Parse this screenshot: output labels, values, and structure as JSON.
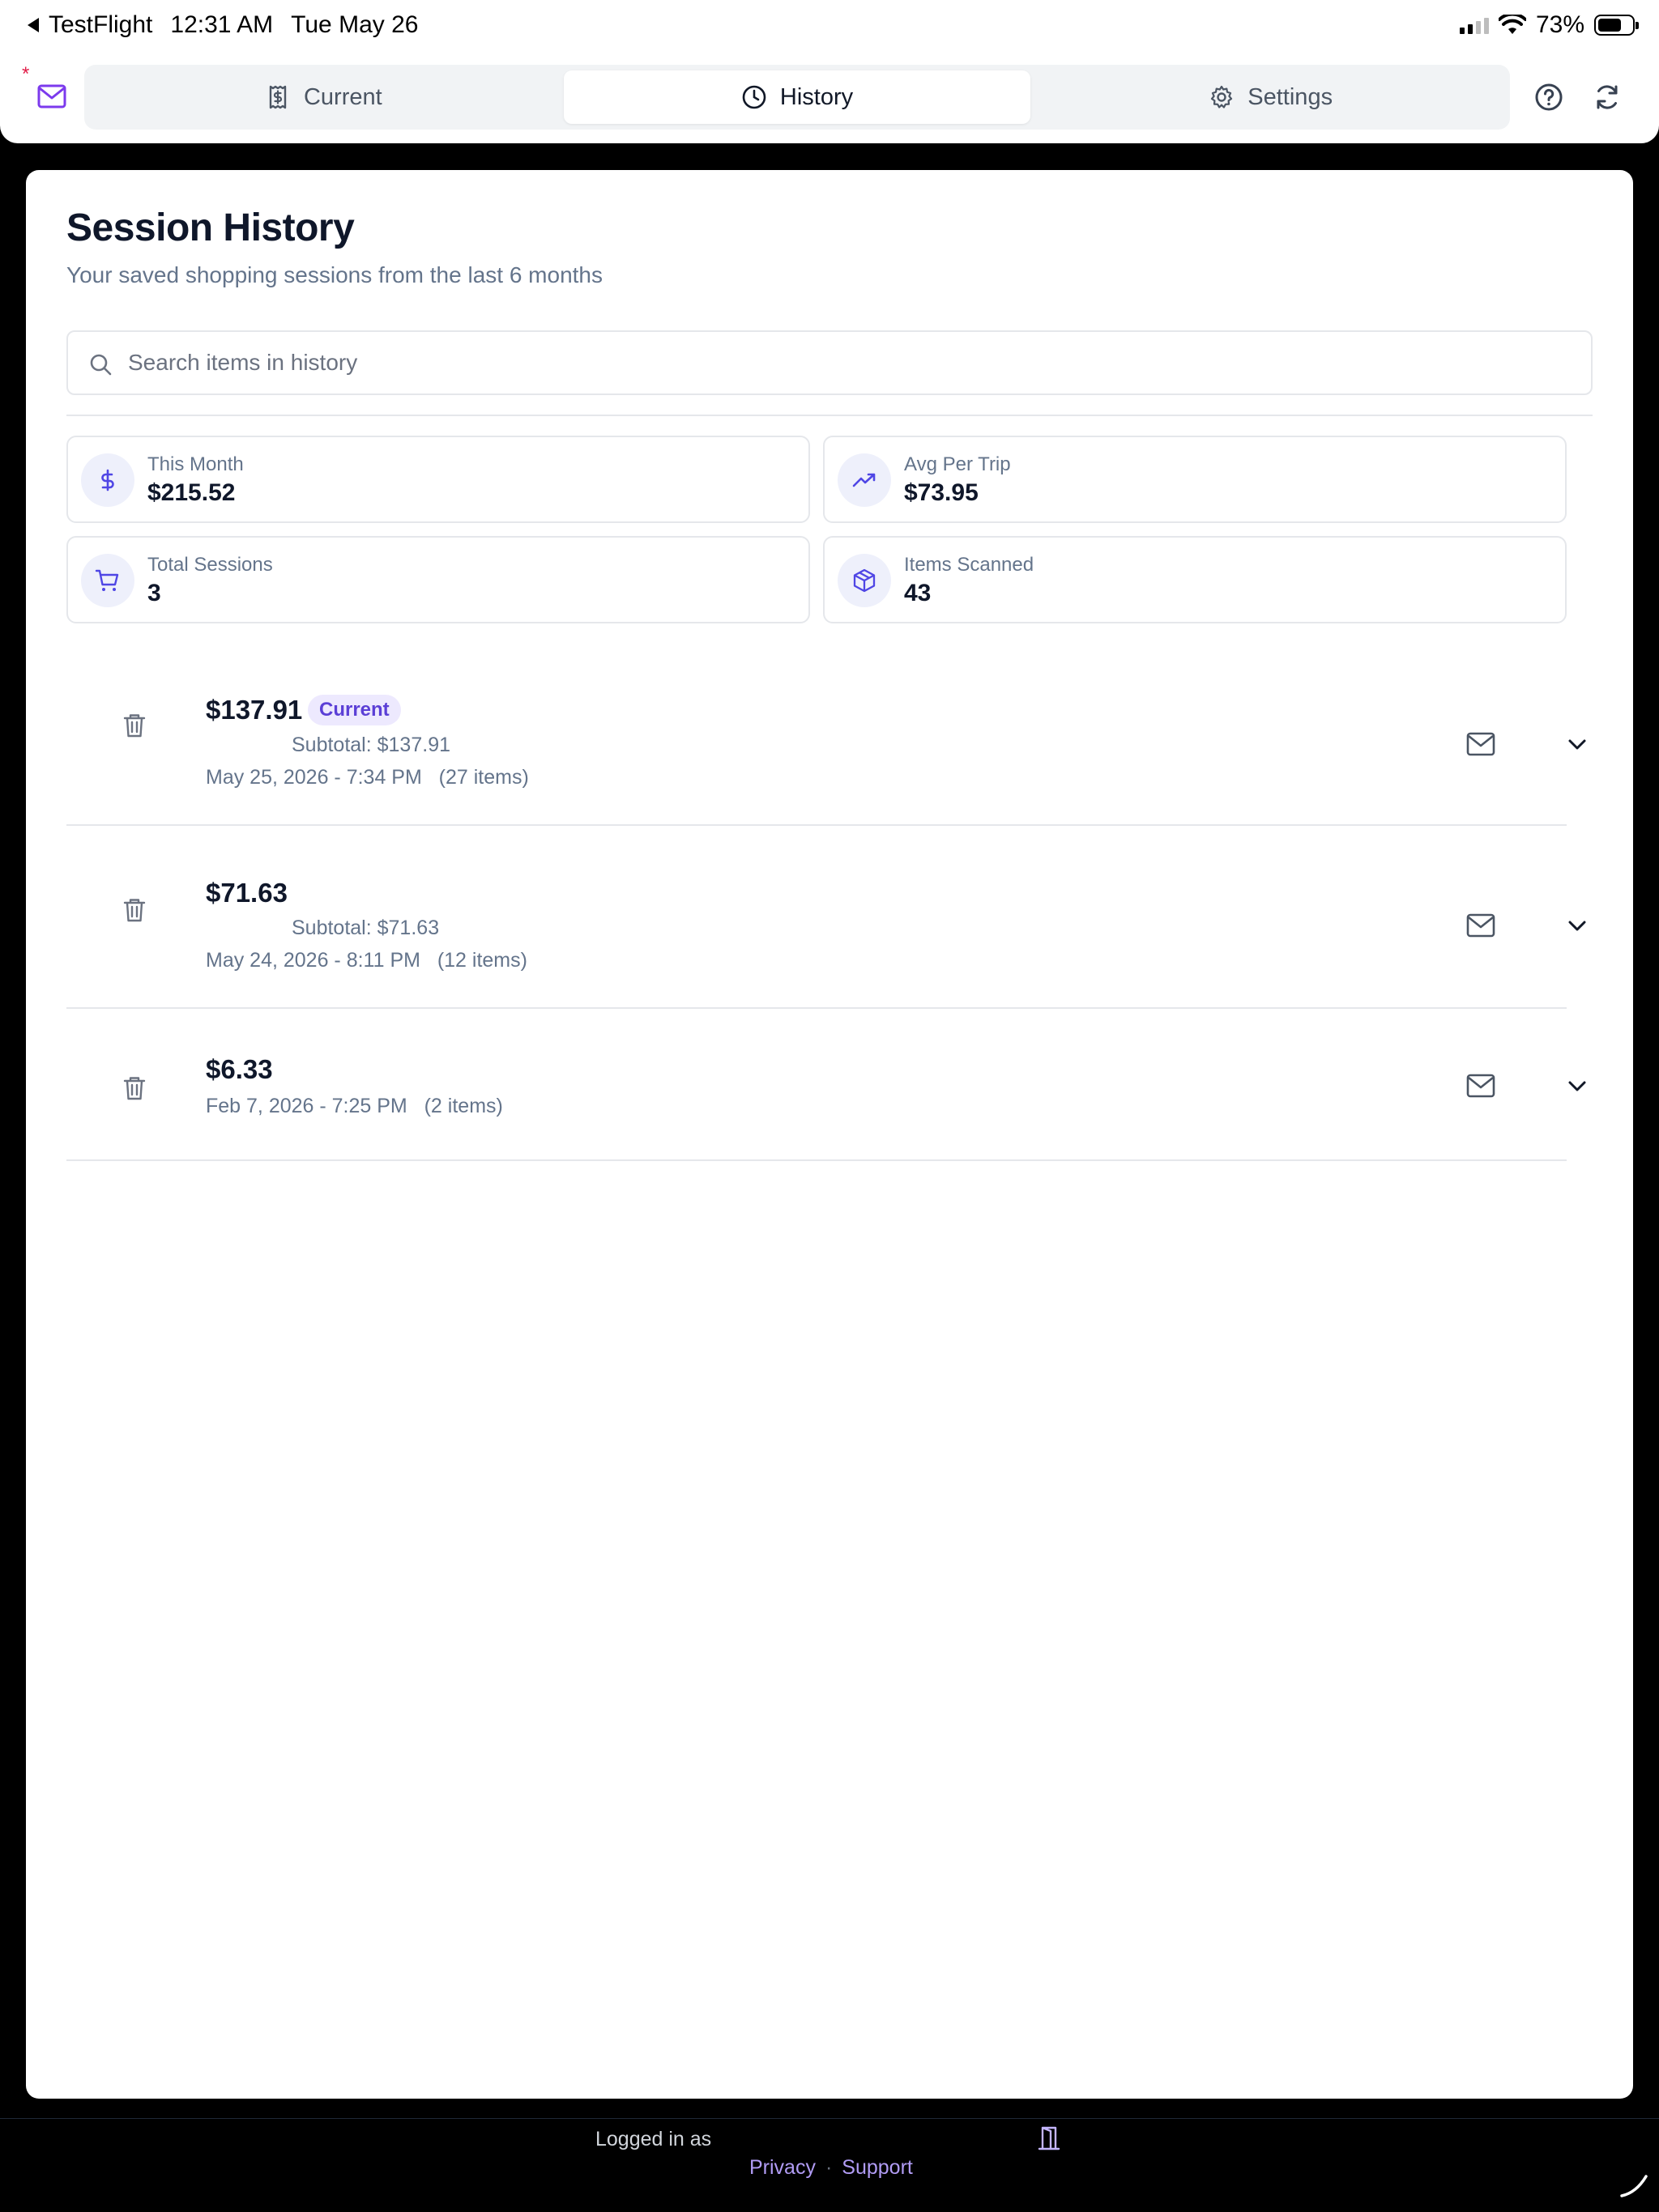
{
  "status_bar": {
    "back_app": "TestFlight",
    "time": "12:31 AM",
    "date": "Tue May 26",
    "battery": "73%",
    "battery_level": 0.73
  },
  "header": {
    "notification_marker": "*",
    "tabs": [
      {
        "label": "Current",
        "icon": "receipt-dollar-icon",
        "active": false
      },
      {
        "label": "History",
        "icon": "clock-icon",
        "active": true
      },
      {
        "label": "Settings",
        "icon": "gear-icon",
        "active": false
      }
    ],
    "icons": [
      "mail-icon",
      "help-circle-icon",
      "refresh-icon"
    ]
  },
  "page": {
    "title": "Session History",
    "subtitle": "Your saved shopping sessions from the last 6 months"
  },
  "search": {
    "placeholder": "Search items in history",
    "value": ""
  },
  "stats": [
    {
      "label": "This Month",
      "value": "$215.52",
      "icon": "dollar-icon"
    },
    {
      "label": "Avg Per Trip",
      "value": "$73.95",
      "icon": "trending-up-icon"
    },
    {
      "label": "Total Sessions",
      "value": "3",
      "icon": "cart-icon"
    },
    {
      "label": "Items Scanned",
      "value": "43",
      "icon": "package-icon"
    }
  ],
  "sessions": [
    {
      "amount": "$137.91",
      "badge": "Current",
      "subtotal": "Subtotal: $137.91",
      "date": "May 25, 2026 - 7:34 PM",
      "items": "(27 items)"
    },
    {
      "amount": "$71.63",
      "badge": "",
      "subtotal": "Subtotal: $71.63",
      "date": "May 24, 2026 - 8:11 PM",
      "items": "(12 items)"
    },
    {
      "amount": "$6.33",
      "badge": "",
      "subtotal": "",
      "date": "Feb 7, 2026 - 7:25 PM",
      "items": "(2 items)"
    }
  ],
  "footer": {
    "logged_in": "Logged in as",
    "privacy": "Privacy",
    "separator": "·",
    "support": "Support"
  },
  "colors": {
    "accent": "#5b3fd6",
    "badge_bg": "#ede9fe",
    "muted_text": "#64748b",
    "footer_link": "#b19cf5"
  }
}
